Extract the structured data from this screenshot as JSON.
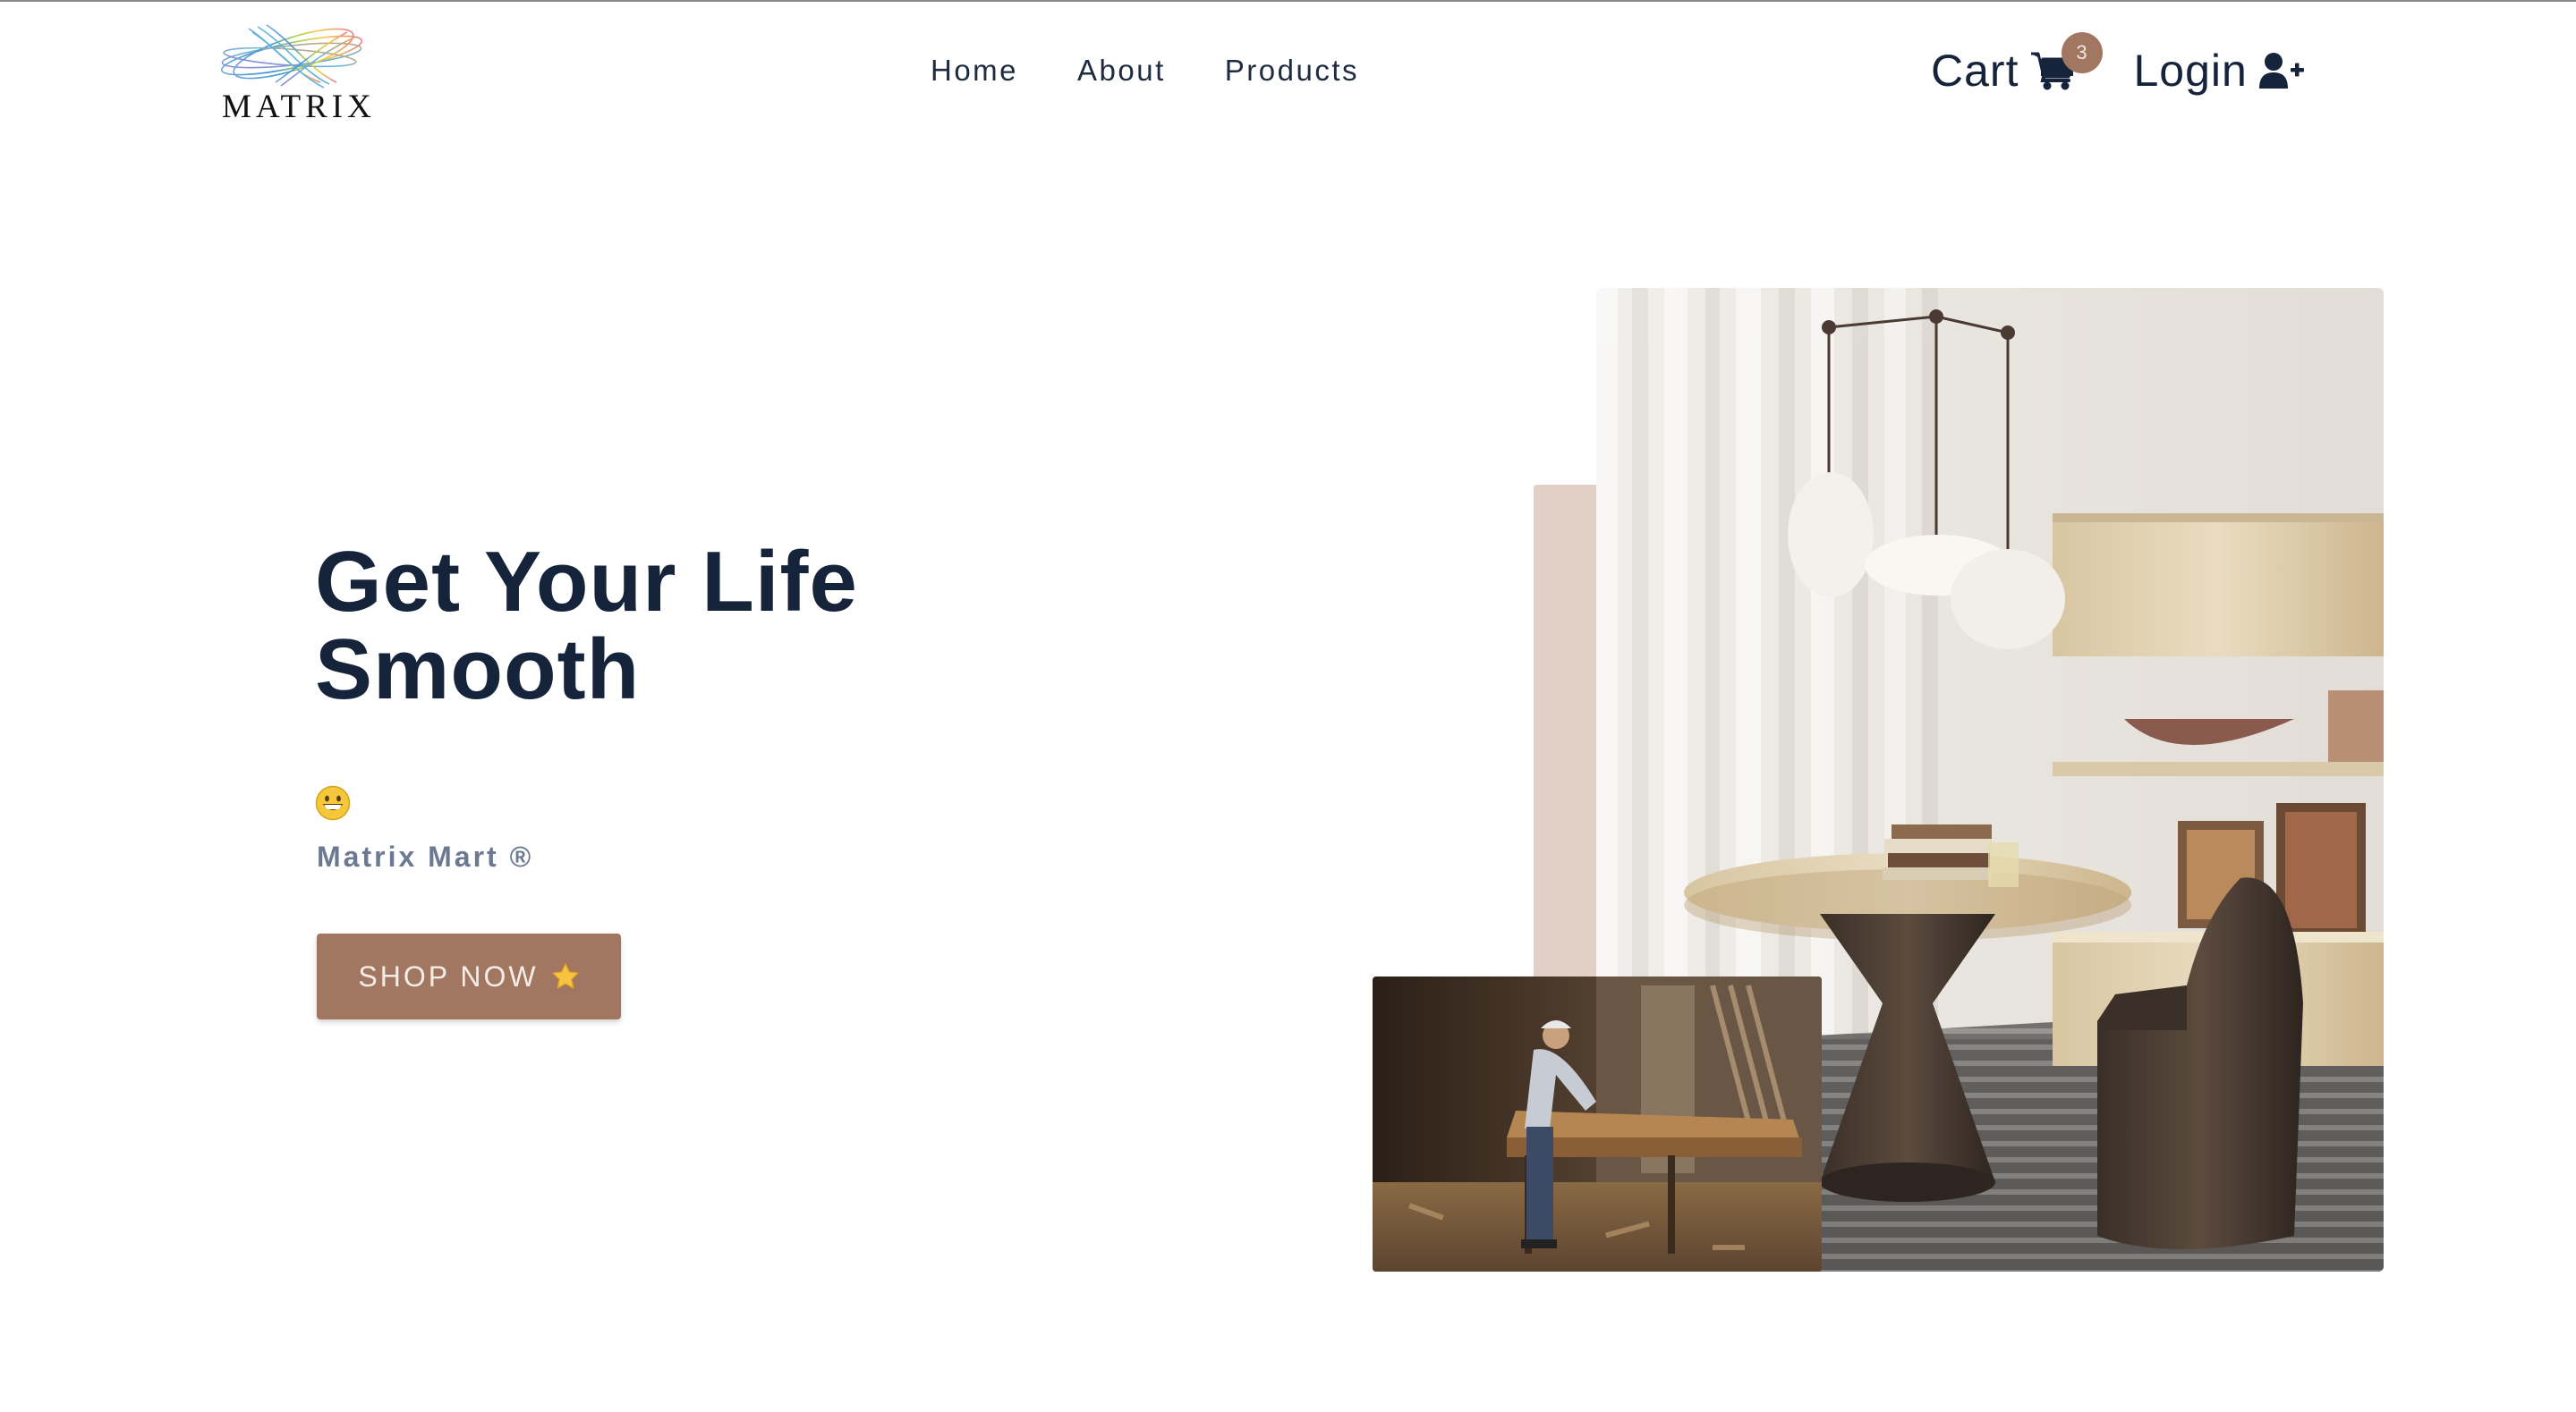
{
  "brand": {
    "logo_text": "MATRIX"
  },
  "nav": {
    "links": [
      "Home",
      "About",
      "Products"
    ]
  },
  "actions": {
    "cart_label": "Cart",
    "cart_count": "3",
    "login_label": "Login"
  },
  "hero": {
    "title": "Get Your Life Smooth",
    "brand_line": "Matrix Mart ®",
    "cta_label": "SHOP NOW"
  },
  "icons": {
    "cart": "shopping-cart-icon",
    "login": "user-plus-icon",
    "emoji": "grinning-face-emoji",
    "star": "star-emoji"
  },
  "colors": {
    "primary_text": "#16243b",
    "accent": "#a27762",
    "muted_text": "#6b7a92",
    "accent_block": "#e2cfc5"
  }
}
